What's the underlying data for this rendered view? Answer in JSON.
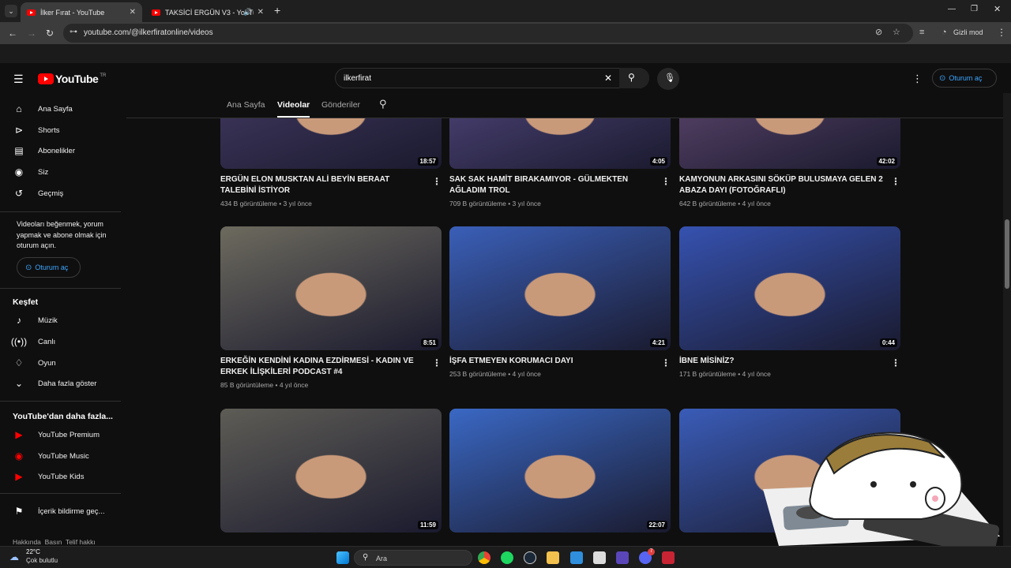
{
  "browser": {
    "tabs": [
      {
        "title": "İlker Fırat - YouTube",
        "active": true
      },
      {
        "title": "TAKSİCİ ERGÜN V3 - YouTu",
        "active": false
      }
    ],
    "new_tab": "+",
    "url": "youtube.com/@ilkerfiratonline/videos",
    "incognito_label": "Gizli mod"
  },
  "youtube": {
    "logo_text": "YouTube",
    "logo_region": "TR",
    "search_value": "ilkerfirat",
    "signin_label": "Oturum aç"
  },
  "sidebar": {
    "items": [
      {
        "label": "Ana Sayfa",
        "icon": "home-icon"
      },
      {
        "label": "Shorts",
        "icon": "shorts-icon"
      },
      {
        "label": "Abonelikler",
        "icon": "subscriptions-icon"
      },
      {
        "label": "Siz",
        "icon": "you-icon"
      },
      {
        "label": "Geçmiş",
        "icon": "history-icon"
      }
    ],
    "signin_prompt": "Videoları beğenmek, yorum yapmak ve abone olmak için oturum açın.",
    "signin_button": "Oturum aç",
    "explore_title": "Keşfet",
    "explore_items": [
      {
        "label": "Müzik",
        "icon": "music-icon"
      },
      {
        "label": "Canlı",
        "icon": "live-icon"
      },
      {
        "label": "Oyun",
        "icon": "gaming-icon"
      },
      {
        "label": "Daha fazla göster",
        "icon": "chevron-down-icon"
      }
    ],
    "more_title": "YouTube'dan daha fazla...",
    "more_items": [
      {
        "label": "YouTube Premium"
      },
      {
        "label": "YouTube Music"
      },
      {
        "label": "YouTube Kids"
      }
    ],
    "report_item": "İçerik bildirme geç...",
    "footer_text": "Hakkında  Basın  Telif hakkı"
  },
  "channel_tabs": [
    "Ana Sayfa",
    "Videolar",
    "Gönderiler"
  ],
  "videos": [
    {
      "title": "ERGÜN ELON MUSKTAN ALİ BEYİN BERAAT TALEBİNİ İSTİYOR",
      "views": "434 B görüntüleme",
      "age": "3 yıl önce",
      "duration": "18:57",
      "color": "#4a3f6b"
    },
    {
      "title": "SAK SAK HAMİT BIRAKAMIYOR - GÜLMEKTEN AĞLADIM TROL",
      "views": "709 B görüntüleme",
      "age": "3 yıl önce",
      "duration": "4:05",
      "color": "#5a4e8a"
    },
    {
      "title": "KAMYONUN ARKASINI SÖKÜP BULUSMAYA GELEN 2 ABAZA DAYI  (FOTOĞRAFLI)",
      "views": "642 B görüntüleme",
      "age": "4 yıl önce",
      "duration": "42:02",
      "color": "#6b4f7a"
    },
    {
      "title": "ERKEĞİN KENDİNİ KADINA EZDİRMESİ - KADIN VE ERKEK İLİŞKİLERİ PODCAST #4",
      "views": "85 B görüntüleme",
      "age": "4 yıl önce",
      "duration": "8:51",
      "color": "#6d6a5e"
    },
    {
      "title": "İŞFA ETMEYEN KORUMACI DAYI",
      "views": "253 B görüntüleme",
      "age": "4 yıl önce",
      "duration": "4:21",
      "color": "#3a5fb8"
    },
    {
      "title": "İBNE MİSİNİZ?",
      "views": "171 B görüntüleme",
      "age": "4 yıl önce",
      "duration": "0:44",
      "color": "#3652b0"
    },
    {
      "title": "",
      "views": "",
      "age": "",
      "duration": "11:59",
      "color": "#5e5c55"
    },
    {
      "title": "",
      "views": "",
      "age": "",
      "duration": "22:07",
      "color": "#3a68c4"
    },
    {
      "title": "",
      "views": "",
      "age": "",
      "duration": "",
      "color": "#3a5cb8"
    }
  ],
  "taskbar": {
    "weather_temp": "22°C",
    "weather_desc": "Çok bulutlu",
    "search_placeholder": "Ara",
    "discord_badge": "7"
  }
}
